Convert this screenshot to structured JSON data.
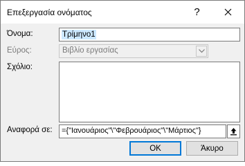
{
  "window": {
    "title": "Επεξεργασία ονόματος",
    "help_label": "?",
    "close_label": "✕"
  },
  "form": {
    "name_label": "Όνομα:",
    "name_value": "Τρίμηνο1",
    "scope_label": "Εύρος:",
    "scope_value": "Βιβλίο εργασίας",
    "comment_label": "Σχόλιο:",
    "comment_value": "",
    "refers_to_label": "Αναφορά σε:",
    "refers_to_value": "={\"Ιανουάριος\"\\\"Φεβρουάριος\"\\\"Μάρτιος\"}"
  },
  "buttons": {
    "ok_label": "OK",
    "cancel_label": "Άκυρο"
  }
}
